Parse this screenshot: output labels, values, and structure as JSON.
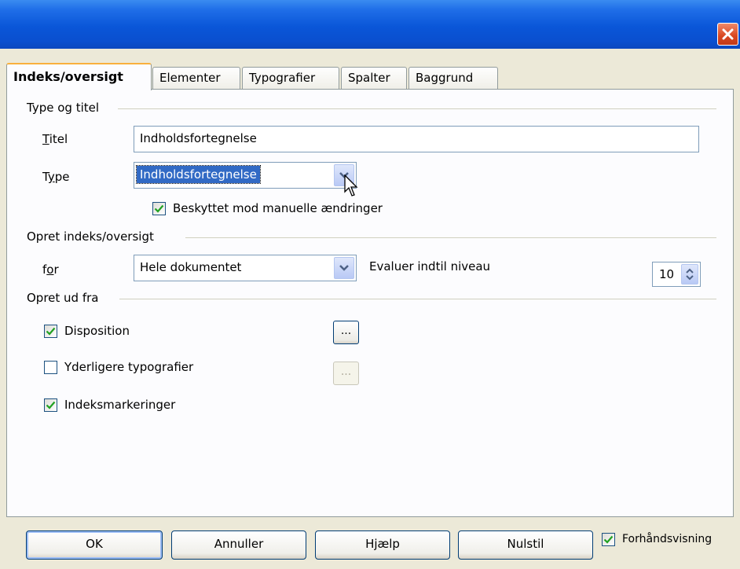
{
  "window": {
    "close_icon": "close-x-icon"
  },
  "tabs": [
    {
      "label": "Indeks/oversigt",
      "active": true
    },
    {
      "label": "Elementer"
    },
    {
      "label": "Typografier"
    },
    {
      "label": "Spalter"
    },
    {
      "label": "Baggrund"
    }
  ],
  "type_group": {
    "title": "Type og titel",
    "title_label": "Titel",
    "title_value": "Indholdsfortegnelse",
    "type_label": "Type",
    "type_value": "Indholdsfortegnelse",
    "protect_label": "Beskyttet mod manuelle ændringer",
    "protect_checked": true
  },
  "create_group": {
    "title": "Opret indeks/oversigt",
    "for_label": "for",
    "for_value": "Hele dokumentet",
    "level_label": "Evaluer indtil niveau",
    "level_value": "10"
  },
  "from_group": {
    "title": "Opret ud fra",
    "outline_label": "Disposition",
    "outline_checked": true,
    "outline_button": "...",
    "styles_label": "Yderligere typografier",
    "styles_checked": false,
    "styles_button": "...",
    "marks_label": "Indeksmarkeringer",
    "marks_checked": true
  },
  "buttons": {
    "ok": "OK",
    "cancel": "Annuller",
    "help": "Hjælp",
    "reset": "Nulstil"
  },
  "preview": {
    "label": "Forhåndsvisning",
    "checked": true
  },
  "colors": {
    "accent": "#316ac5",
    "titlebar": "#0a56d8",
    "close": "#d8461f",
    "check": "#21a121"
  }
}
